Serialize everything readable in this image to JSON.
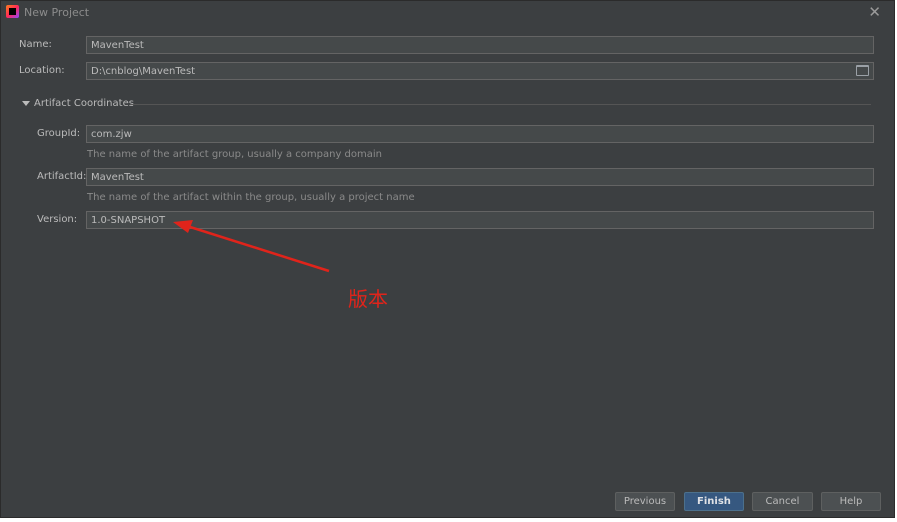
{
  "window": {
    "title": "New Project"
  },
  "form": {
    "name_label": "Name:",
    "name_value": "MavenTest",
    "location_label": "Location:",
    "location_value": "D:\\cnblog\\MavenTest"
  },
  "artifact": {
    "section_title": "Artifact Coordinates",
    "groupid_label": "GroupId:",
    "groupid_value": "com.zjw",
    "groupid_hint": "The name of the artifact group, usually a company domain",
    "artifactid_label": "ArtifactId:",
    "artifactid_value": "MavenTest",
    "artifactid_hint": "The name of the artifact within the group, usually a project name",
    "version_label": "Version:",
    "version_value": "1.0-SNAPSHOT"
  },
  "annotation": {
    "text": "版本",
    "color": "#e0241b"
  },
  "buttons": {
    "previous": "Previous",
    "finish": "Finish",
    "cancel": "Cancel",
    "help": "Help"
  },
  "icons": {
    "app": "intellij-idea-icon",
    "close": "close-icon",
    "folder": "folder-icon",
    "expand": "triangle-down-icon"
  },
  "colors": {
    "background": "#3c3f41",
    "field": "#45494a",
    "primary_button": "#365880",
    "text": "#bbbbbb"
  }
}
